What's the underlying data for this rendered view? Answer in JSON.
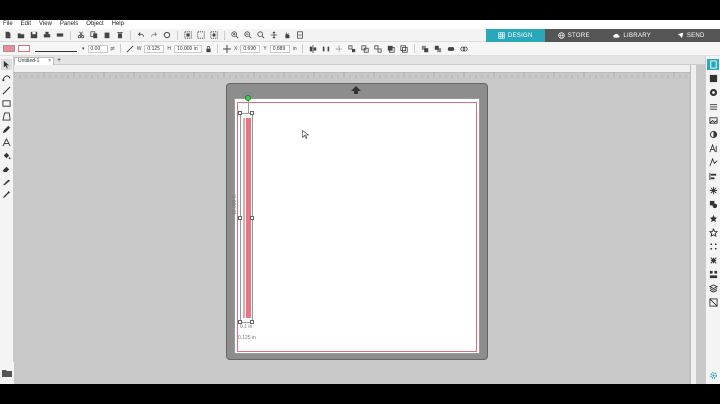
{
  "menu": [
    "File",
    "Edit",
    "View",
    "Panels",
    "Object",
    "Help"
  ],
  "top_tabs": [
    {
      "label": "DESIGN",
      "icon": "grid-icon",
      "active": true
    },
    {
      "label": "STORE",
      "icon": "globe-icon",
      "active": false
    },
    {
      "label": "LIBRARY",
      "icon": "cloud-icon",
      "active": false
    },
    {
      "label": "SEND",
      "icon": "send-icon",
      "active": false
    }
  ],
  "properties": {
    "line_width": "0.00",
    "line_unit": "pt",
    "w_label": "W",
    "w_value": "0.125",
    "h_label": "H",
    "h_value": "10.000 in",
    "x_label": "X",
    "x_value": "0.690",
    "y_label": "Y",
    "y_value": "0.889",
    "pos_unit": "in",
    "fill_color": "#f08a96",
    "line_color": "#e26f7b"
  },
  "document": {
    "tab_title": "Untitled-1",
    "close": "×",
    "add": "+"
  },
  "selection": {
    "height_label": "10.000 in",
    "width_label": "0.125 in",
    "handle_label": "0.1 in"
  },
  "colors": {
    "accent": "#2aa7b8",
    "cut_line": "#e26f7b",
    "mat": "#8d8d8d",
    "rotate_handle": "#3bd14d"
  }
}
